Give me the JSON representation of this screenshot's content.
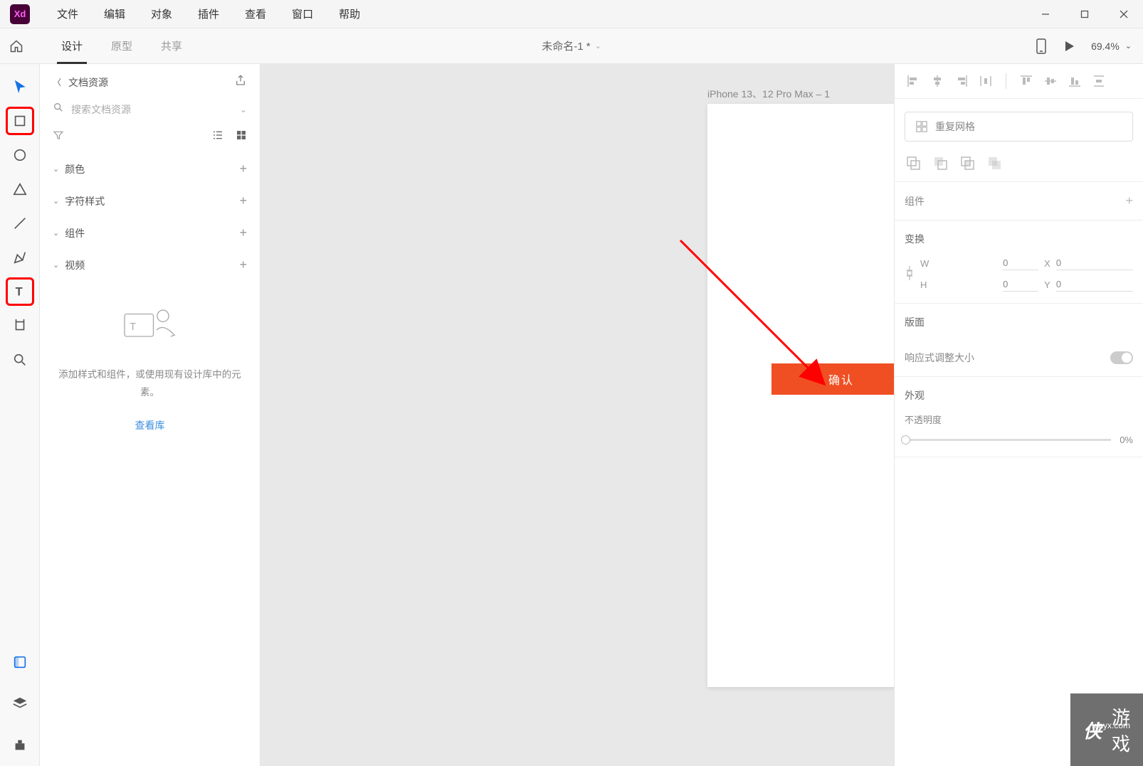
{
  "app_logo": "Xd",
  "menu": [
    "文件",
    "编辑",
    "对象",
    "插件",
    "查看",
    "窗口",
    "帮助"
  ],
  "toolbar": {
    "tabs": [
      "设计",
      "原型",
      "共享"
    ],
    "active_tab": 0,
    "doc_title": "未命名-1 *",
    "zoom": "69.4%"
  },
  "assets": {
    "title": "文档资源",
    "search_placeholder": "搜索文档资源",
    "sections": [
      "颜色",
      "字符样式",
      "组件",
      "视频"
    ],
    "empty_text": "添加样式和组件，或使用现有设计库中的元素。",
    "view_lib": "查看库"
  },
  "canvas": {
    "artboard_label": "iPhone 13、12 Pro Max – 1",
    "button_text": "确认"
  },
  "rpanel": {
    "repeat_grid": "重复网格",
    "component": "组件",
    "transform": "变换",
    "w": "W",
    "w_val": "0",
    "x": "X",
    "x_val": "0",
    "h": "H",
    "h_val": "0",
    "y": "Y",
    "y_val": "0",
    "layout": "版面",
    "responsive": "响应式调整大小",
    "appearance": "外观",
    "opacity_label": "不透明度",
    "opacity_val": "0%"
  },
  "watermark": {
    "site": "xiayx.com",
    "text": "游戏"
  }
}
